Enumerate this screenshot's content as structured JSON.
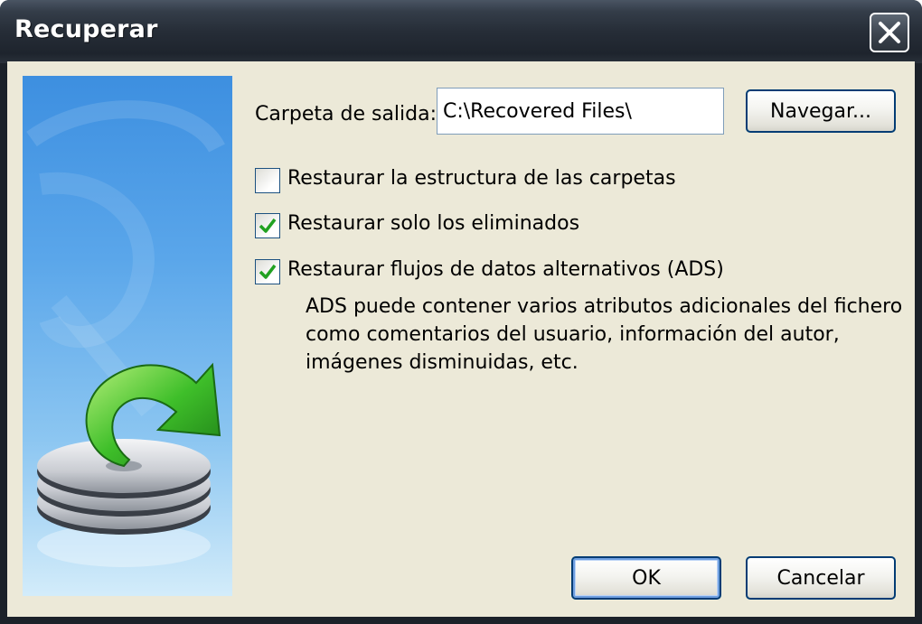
{
  "window": {
    "title": "Recuperar",
    "close_label": "close",
    "close_icon": "close-icon"
  },
  "output": {
    "label": "Carpeta de salida:",
    "value": "C:\\Recovered Files\\",
    "browse_button": "Navegar..."
  },
  "options": [
    {
      "label": "Restaurar la estructura de las carpetas",
      "checked": false
    },
    {
      "label": "Restaurar solo los eliminados",
      "checked": true
    },
    {
      "label": "Restaurar flujos de datos alternativos (ADS)",
      "checked": true
    }
  ],
  "ads_description": "ADS puede contener varios atributos  adicionales del fichero como comentarios del usuario, información del autor, imágenes disminuidas, etc.",
  "buttons": {
    "ok": "OK",
    "cancel": "Cancelar"
  },
  "side_image": {
    "icon": "recover-disks-arrow-icon"
  },
  "colors": {
    "dialog_bg": "#ece9d8",
    "titlebar": "#262d37",
    "button_border": "#003c74",
    "check_mark": "#21a121",
    "side_panel_blue": "#4f9fe6"
  }
}
